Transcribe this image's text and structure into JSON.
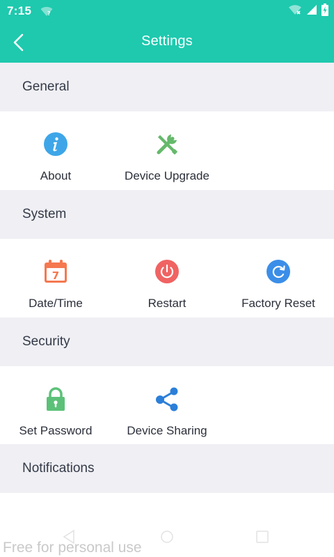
{
  "status_bar": {
    "time": "7:15",
    "icons": [
      "wifi-question-icon",
      "wifi-off-icon",
      "signal-icon",
      "battery-charging-icon"
    ]
  },
  "header": {
    "title": "Settings",
    "back_icon": "chevron-left-icon"
  },
  "colors": {
    "accent": "#1ec9ae",
    "section_bg": "#efeff4",
    "about_icon": "#3ea6e8",
    "upgrade_icon": "#65b96b",
    "date_icon": "#f5784f",
    "restart_icon": "#f06363",
    "reset_icon": "#3b8ee8",
    "password_icon": "#5cc178",
    "sharing_icon": "#2c7fd8"
  },
  "sections": {
    "general": {
      "title": "General",
      "items": [
        {
          "label": "About",
          "icon": "info-icon"
        },
        {
          "label": "Device Upgrade",
          "icon": "tools-icon"
        }
      ]
    },
    "system": {
      "title": "System",
      "items": [
        {
          "label": "Date/Time",
          "icon": "calendar-icon"
        },
        {
          "label": "Restart",
          "icon": "power-icon"
        },
        {
          "label": "Factory Reset",
          "icon": "refresh-icon"
        }
      ]
    },
    "security": {
      "title": "Security",
      "items": [
        {
          "label": "Set Password",
          "icon": "lock-icon"
        },
        {
          "label": "Device Sharing",
          "icon": "share-icon"
        }
      ]
    },
    "notifications": {
      "title": "Notifications"
    }
  },
  "calendar_day": "7",
  "watermark": "Free for personal use"
}
